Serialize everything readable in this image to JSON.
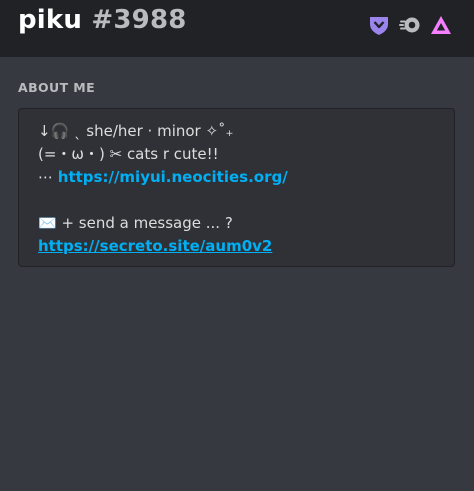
{
  "profile": {
    "username": "piku",
    "discriminator": "#3988",
    "badges": [
      {
        "icon": "hypesquad-balance-icon",
        "color": "#9b84ec"
      },
      {
        "icon": "nitro-boost-icon",
        "color": "#b9bbbe"
      },
      {
        "icon": "triangle-badge-icon",
        "color": "#f47fff"
      }
    ]
  },
  "about": {
    "section_title": "ABOUT ME",
    "line1": "↓🎧 ˎ she/her · minor ✧˚₊",
    "line2": "(=・ω・) ✂ cats r cute!!",
    "line3_prefix": "⋯ ",
    "link1": "https://miyui.neocities.org/",
    "line5": "✉️ + send a message ... ?",
    "link2": "https://secreto.site/aum0v2"
  },
  "colors": {
    "background": "#36393f",
    "header_background": "#202225",
    "about_background": "#2f3136",
    "link": "#00aff4",
    "muted": "#b9bbbe",
    "text": "#dcddde"
  }
}
